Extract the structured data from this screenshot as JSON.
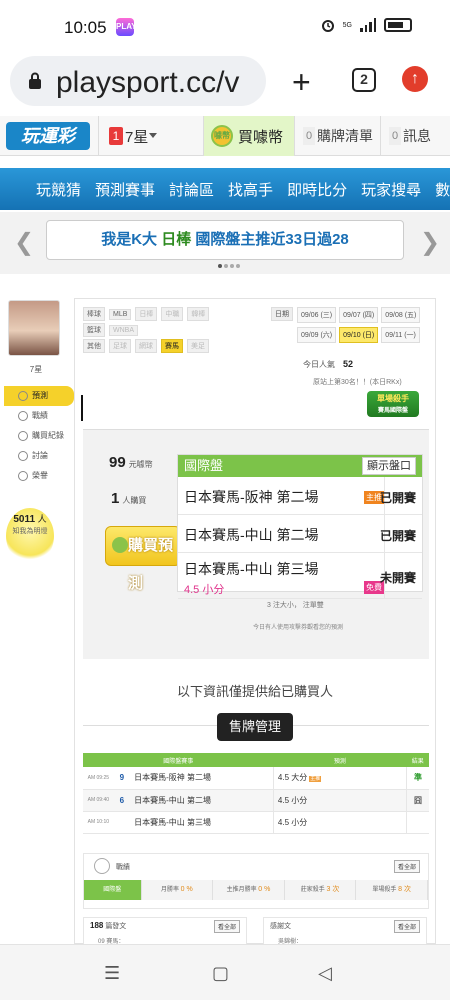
{
  "status_bar": {
    "time": "10:05",
    "app_icon": "game-app-icon",
    "network": "5G",
    "icons": [
      "alarm-icon",
      "signal-icon",
      "battery-icon"
    ]
  },
  "browser": {
    "url": "playsport.cc/v",
    "tab_count": "2",
    "icons": [
      "lock-icon",
      "plus-icon",
      "tabs-icon",
      "update-icon"
    ]
  },
  "site_header": {
    "logo": "玩運彩",
    "level_num": "1",
    "level_label": "7星",
    "buy_coin": "買噱幣",
    "coin_icon_text": "噱幣",
    "cart": {
      "count": "0",
      "label": "購牌清單"
    },
    "messages": {
      "count": "0",
      "label": "訊息"
    }
  },
  "nav": {
    "items": [
      "玩競猜",
      "預測賽事",
      "討論區",
      "找高手",
      "即時比分",
      "玩家搜尋",
      "數據"
    ]
  },
  "banner": {
    "part1": "我是K大",
    "part2": "日棒",
    "part3": "國際盤主推近33日過28"
  },
  "profile": {
    "name": "7星",
    "menu": [
      "預測",
      "戰績",
      "購買紀錄",
      "討論",
      "榮譽"
    ],
    "active_menu": "預測",
    "bulb_count": "5011",
    "bulb_unit": "人",
    "bulb_sub": "知我為明燈"
  },
  "filters": {
    "rows": [
      {
        "label": "棒球",
        "items": [
          {
            "t": "MLB",
            "dim": false
          },
          {
            "t": "日棒",
            "dim": true
          },
          {
            "t": "中職",
            "dim": true
          },
          {
            "t": "韓棒",
            "dim": true
          }
        ]
      },
      {
        "label": "籃球",
        "items": [
          {
            "t": "WNBA",
            "dim": true
          }
        ]
      },
      {
        "label": "其他",
        "items": [
          {
            "t": "足球",
            "dim": true
          },
          {
            "t": "網球",
            "dim": true
          },
          {
            "t": "賽馬",
            "dim": false,
            "hot": true
          },
          {
            "t": "美足",
            "dim": true
          }
        ]
      }
    ],
    "date_label": "日期",
    "dates": [
      "09/06 (三)",
      "09/07 (四)",
      "09/08 (五)",
      "09/09 (六)",
      "09/10 (日)",
      "09/11 (一)"
    ],
    "active_date": "09/10 (日)"
  },
  "today": {
    "label": "今日人氣",
    "value": "52",
    "rank": "原站上第30名！！(本日RKx)"
  },
  "killer_badge": {
    "line1": "單場殺手",
    "line2": "賽馬國際盤"
  },
  "purchase": {
    "coins": "99",
    "coins_unit": "元噱幣",
    "buyers": "1",
    "buyers_unit": "人購買",
    "buy_button": "購買預測"
  },
  "game_panel": {
    "title": "國際盤",
    "toggle_button": "顯示盤口",
    "games": [
      {
        "name": "日本賽馬-阪神 第二場",
        "status": "已開賽",
        "badge": "主推",
        "sub": ""
      },
      {
        "name": "日本賽馬-中山 第二場",
        "status": "已開賽",
        "badge": "",
        "sub": ""
      },
      {
        "name": "日本賽馬-中山 第三場",
        "status": "未開賽",
        "badge": "免費",
        "sub": "4.5 小分"
      }
    ],
    "footer1": "3 注大小， 注單雙",
    "footer2": "今日有人使用攻擊券觀看您的預測"
  },
  "notice": "以下資訊僅提供給已購買人",
  "manage_button": "售牌管理",
  "result_table": {
    "headers": [
      "國際盤賽事",
      "預測",
      "結果"
    ],
    "rows": [
      {
        "time": "AM 09:25",
        "num": "9",
        "game": "日本賽馬-阪神 第二場",
        "pick": "4.5 大分",
        "tag": "主推",
        "result": "準"
      },
      {
        "time": "AM 09:40",
        "num": "6",
        "game": "日本賽馬-中山 第二場",
        "pick": "4.5 小分",
        "tag": "",
        "result": "囧"
      },
      {
        "time": "AM 10:10",
        "num": "",
        "game": "日本賽馬-中山 第三場",
        "pick": "4.5 小分",
        "tag": "",
        "result": ""
      }
    ]
  },
  "record": {
    "title": "戰績",
    "more": "看全部",
    "cells": [
      {
        "label": "國際盤",
        "value": ""
      },
      {
        "label": "月勝率",
        "value": "0 %"
      },
      {
        "label": "主推月勝率",
        "value": "0 %"
      },
      {
        "label": "莊家殺手",
        "value": "3 次"
      },
      {
        "label": "單場殺手",
        "value": "8 次"
      }
    ]
  },
  "bottom": {
    "left": {
      "count": "188",
      "label": "篇發文",
      "more": "看全部",
      "sub": "09 賽馬："
    },
    "right": {
      "label": "感謝文",
      "more": "看全部",
      "sub": "吳錦樹："
    }
  },
  "system_nav": {
    "menu": "☰",
    "home": "▢",
    "back": "◁"
  }
}
